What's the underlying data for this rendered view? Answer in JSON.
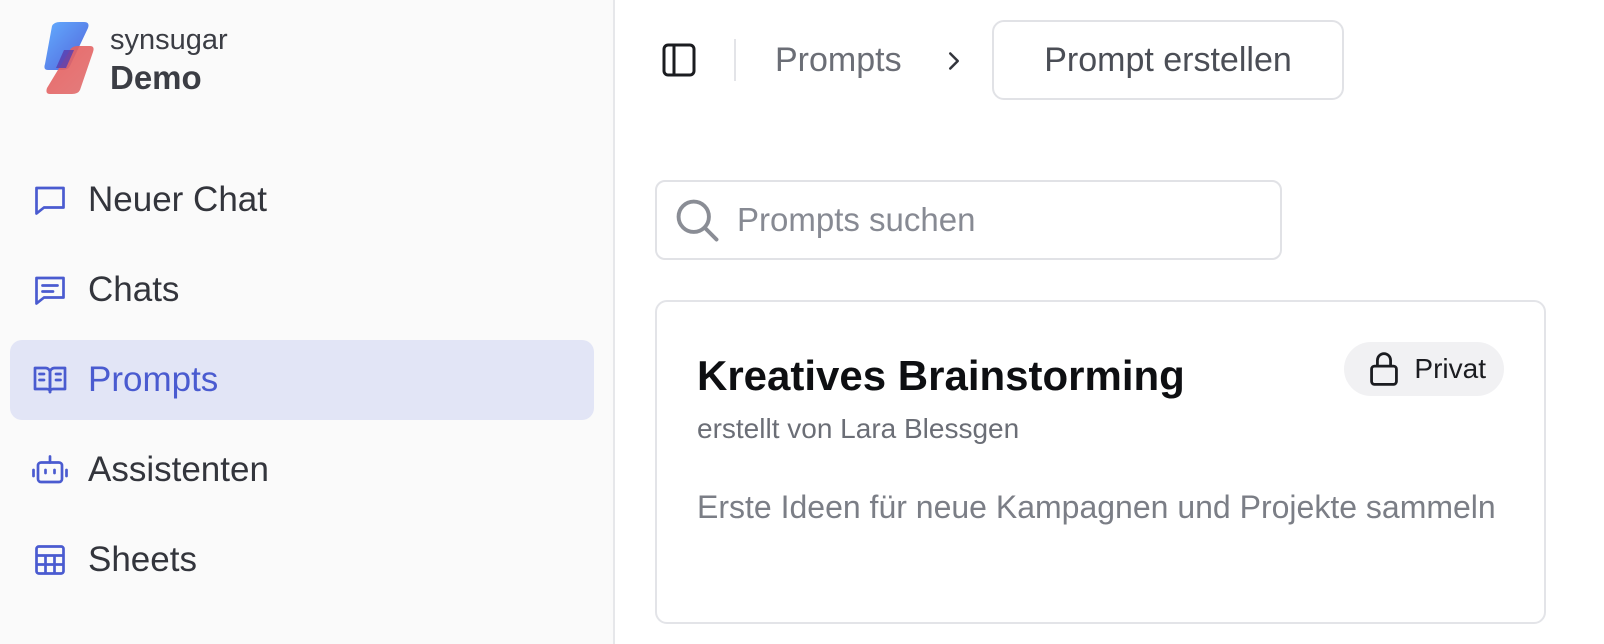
{
  "brand": {
    "org": "synsugar",
    "workspace": "Demo"
  },
  "sidebar": {
    "items": [
      {
        "label": "Neuer Chat",
        "icon": "chat-bubble-icon",
        "active": false
      },
      {
        "label": "Chats",
        "icon": "chat-lines-icon",
        "active": false
      },
      {
        "label": "Prompts",
        "icon": "book-open-icon",
        "active": true
      },
      {
        "label": "Assistenten",
        "icon": "robot-icon",
        "active": false
      },
      {
        "label": "Sheets",
        "icon": "table-icon",
        "active": false
      }
    ]
  },
  "toolbar": {
    "breadcrumb": "Prompts",
    "create_label": "Prompt erstellen"
  },
  "search": {
    "placeholder": "Prompts suchen",
    "value": ""
  },
  "prompts": [
    {
      "title": "Kreatives Brainstorming",
      "author": "erstellt von Lara Blessgen",
      "description": "Erste Ideen für neue Kampagnen und Projekte sammeln",
      "visibility": "Privat"
    }
  ],
  "colors": {
    "accent": "#4a5bd0",
    "active_bg": "#e2e5f6",
    "sidebar_bg": "#fafafa"
  }
}
